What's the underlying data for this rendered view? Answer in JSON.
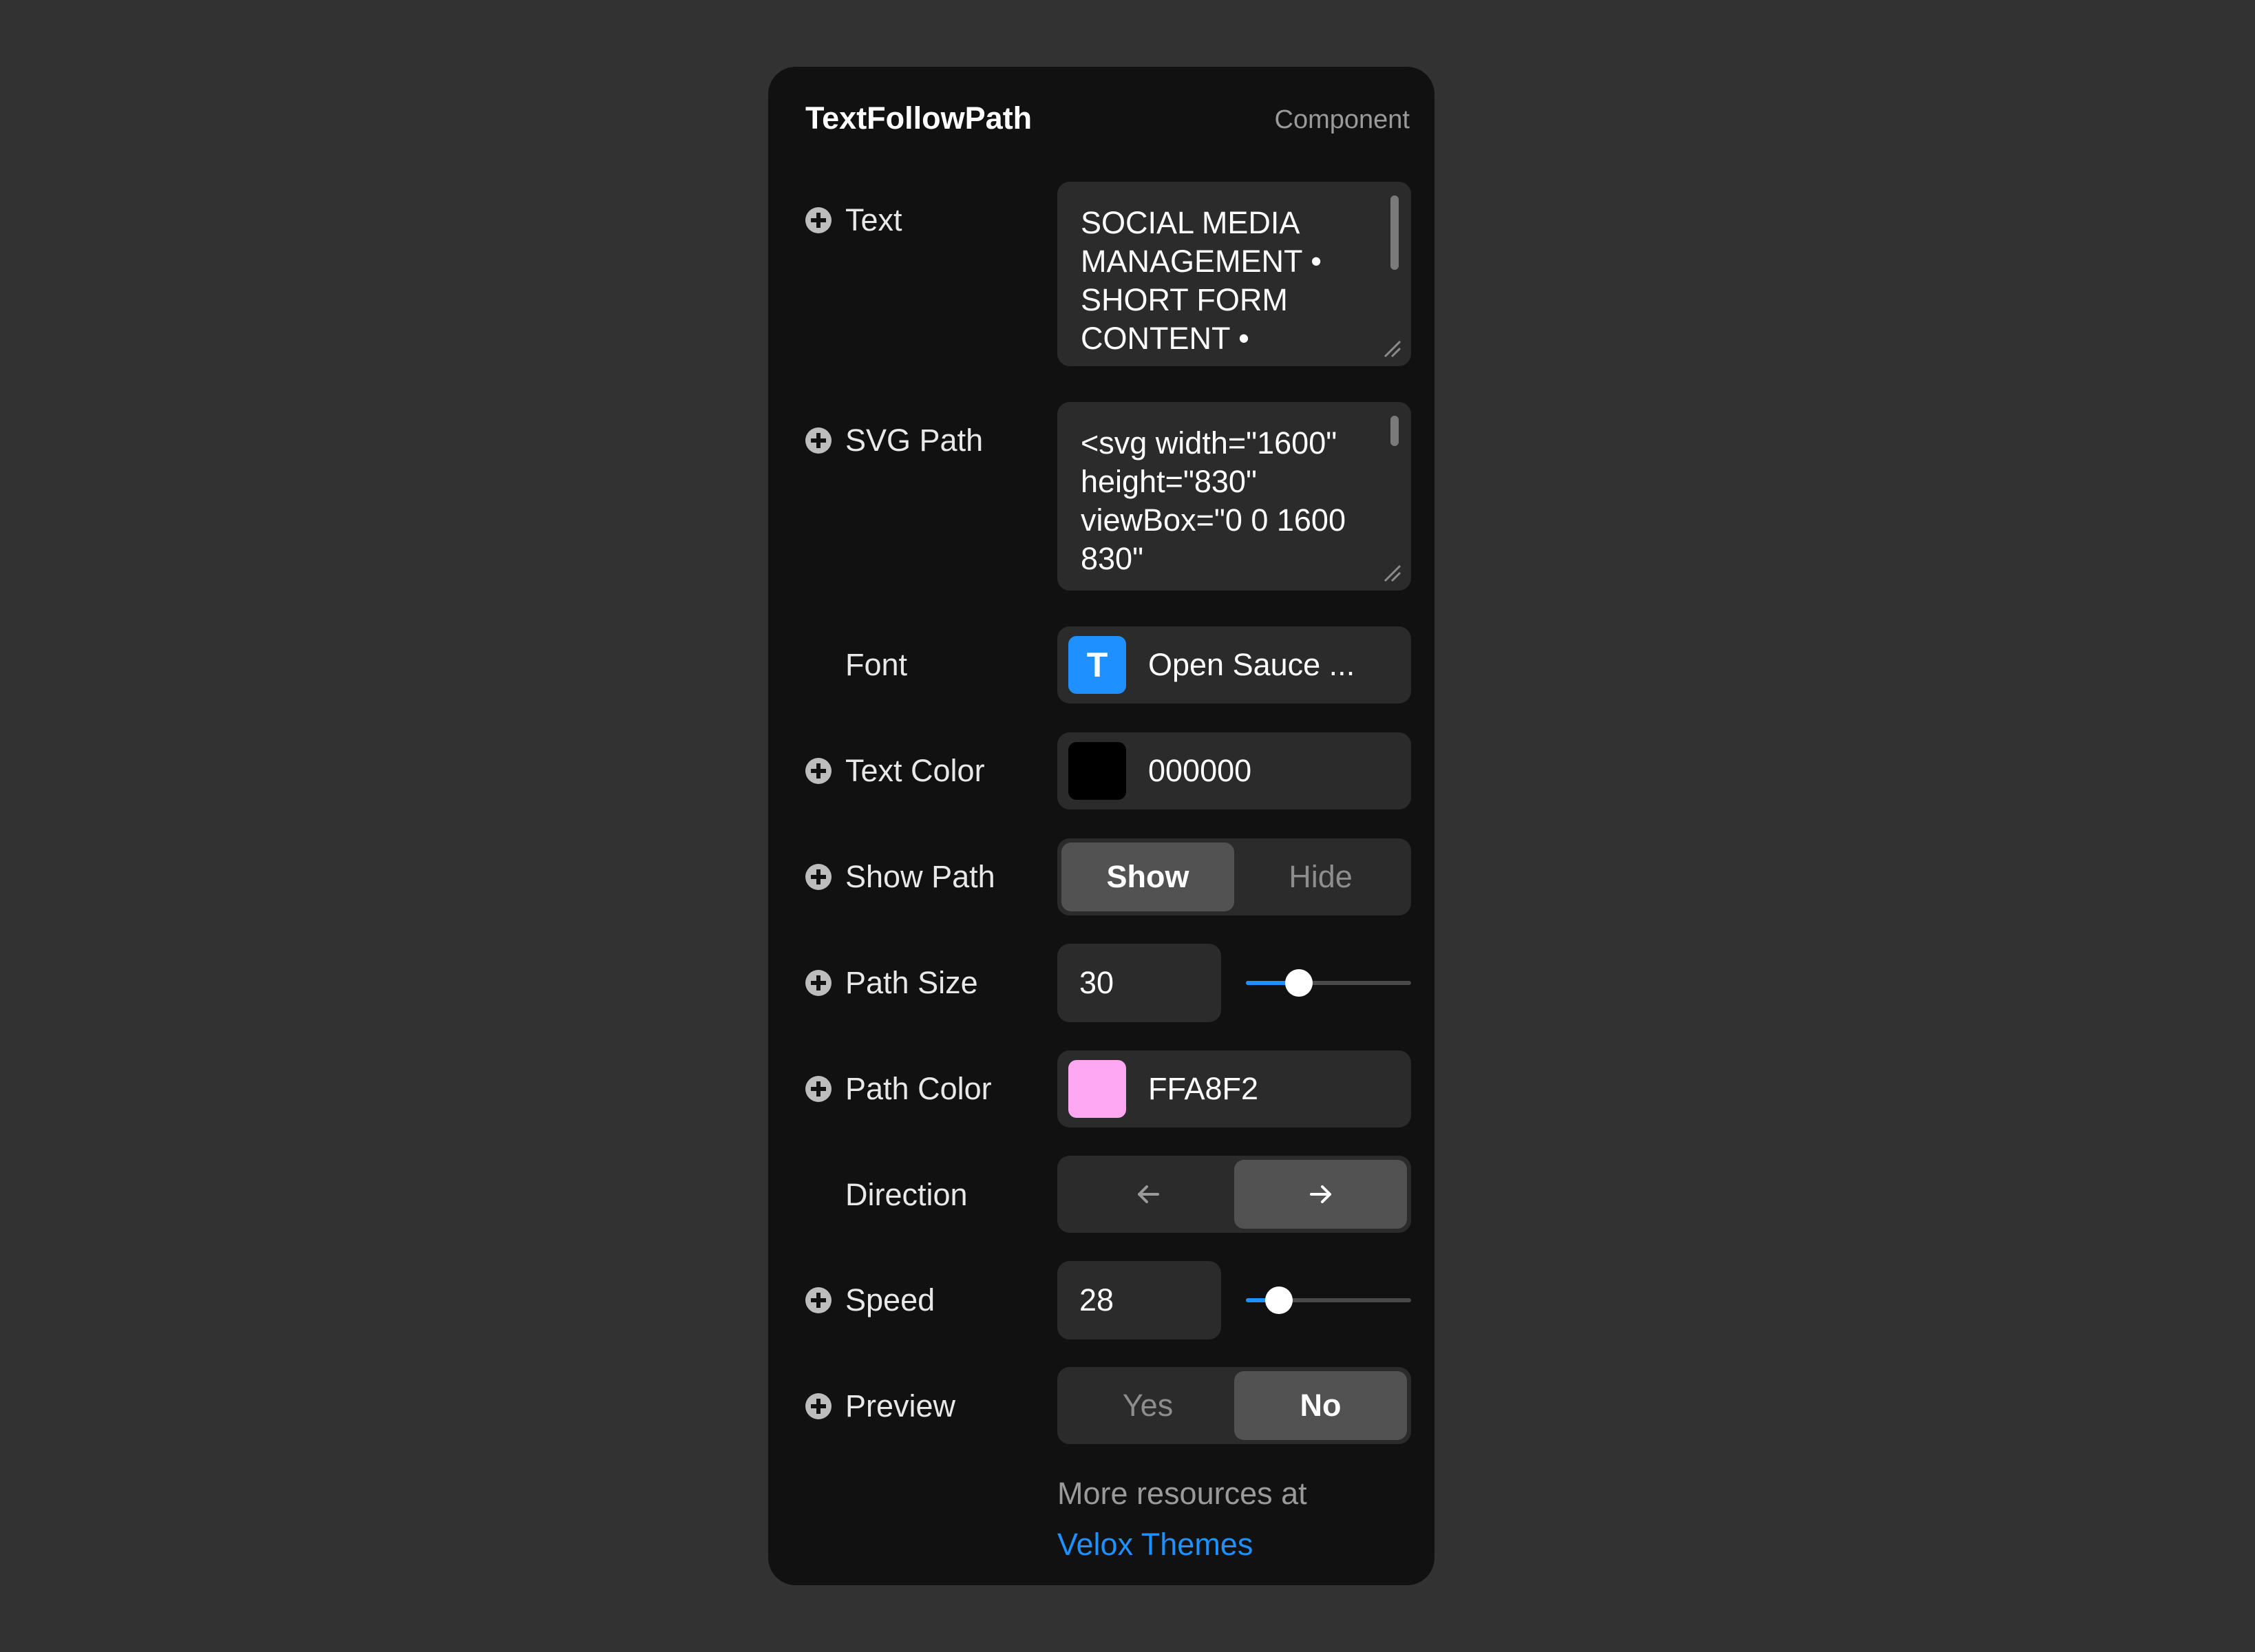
{
  "panel": {
    "title": "TextFollowPath",
    "subtitle": "Component"
  },
  "text": {
    "label": "Text",
    "value": "SOCIAL MEDIA MANAGEMENT • SHORT FORM CONTENT •"
  },
  "svg_path": {
    "label": "SVG Path",
    "value": "<svg width=\"1600\" height=\"830\" viewBox=\"0 0 1600 830\""
  },
  "font": {
    "label": "Font",
    "icon_glyph": "T",
    "value": "Open Sauce ...",
    "icon_color": "#1e90ff"
  },
  "text_color": {
    "label": "Text Color",
    "value": "000000",
    "swatch": "#000000"
  },
  "show_path": {
    "label": "Show Path",
    "options": [
      "Show",
      "Hide"
    ],
    "selected": "Show"
  },
  "path_size": {
    "label": "Path Size",
    "value": "30",
    "slider_fraction": 0.32
  },
  "path_color": {
    "label": "Path Color",
    "value": "FFA8F2",
    "swatch": "#FFA8F2"
  },
  "direction": {
    "label": "Direction",
    "options": [
      "left-arrow-icon",
      "right-arrow-icon"
    ],
    "selected": "right"
  },
  "speed": {
    "label": "Speed",
    "value": "28",
    "slider_fraction": 0.2
  },
  "preview": {
    "label": "Preview",
    "options": [
      "Yes",
      "No"
    ],
    "selected": "No"
  },
  "footer": {
    "text": "More resources at",
    "link": "Velox Themes",
    "link_color": "#1e90ff"
  }
}
